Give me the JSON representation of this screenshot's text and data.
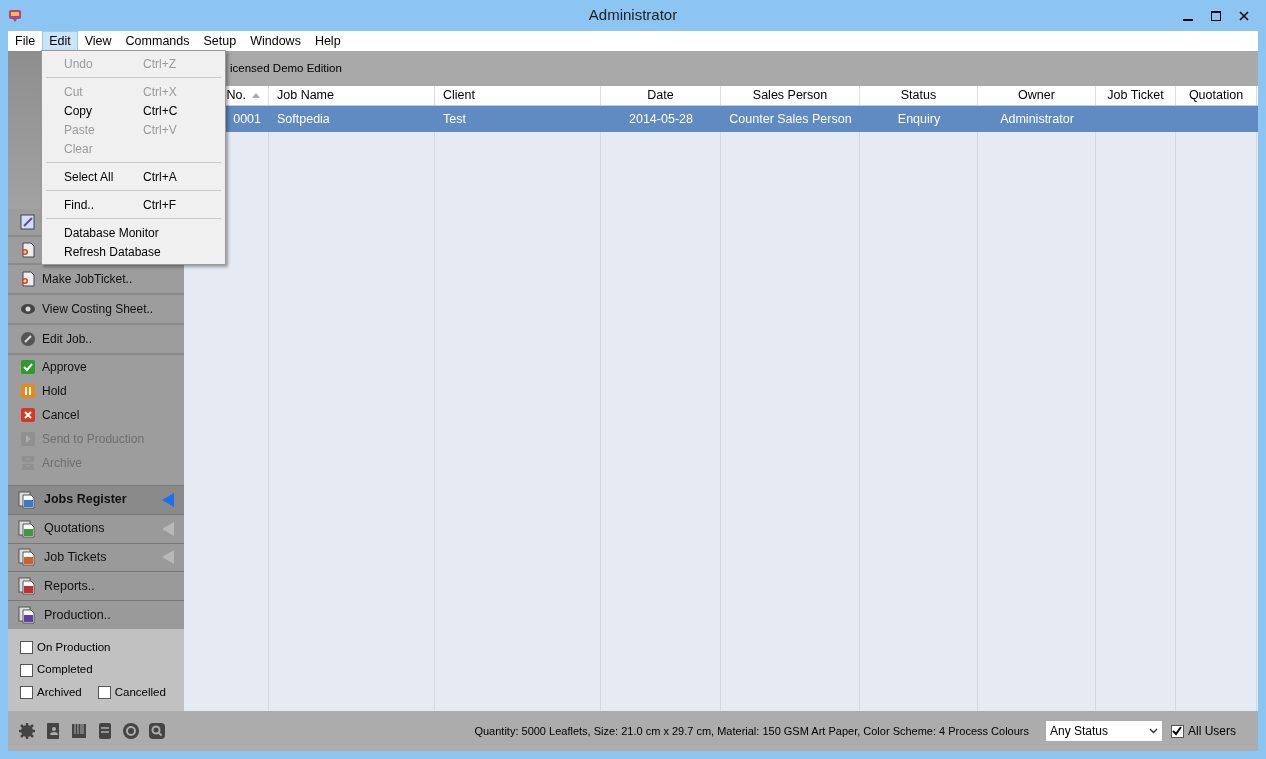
{
  "window": {
    "title": "Administrator"
  },
  "menu_bar": [
    {
      "label": "File",
      "selected": false
    },
    {
      "label": "Edit",
      "selected": true
    },
    {
      "label": "View",
      "selected": false
    },
    {
      "label": "Commands",
      "selected": false
    },
    {
      "label": "Setup",
      "selected": false
    },
    {
      "label": "Windows",
      "selected": false
    },
    {
      "label": "Help",
      "selected": false
    }
  ],
  "edit_menu": [
    {
      "kind": "item",
      "label": "Undo",
      "shortcut": "Ctrl+Z",
      "disabled": true
    },
    {
      "kind": "separator"
    },
    {
      "kind": "item",
      "label": "Cut",
      "shortcut": "Ctrl+X",
      "disabled": true
    },
    {
      "kind": "item",
      "label": "Copy",
      "shortcut": "Ctrl+C",
      "disabled": false
    },
    {
      "kind": "item",
      "label": "Paste",
      "shortcut": "Ctrl+V",
      "disabled": true
    },
    {
      "kind": "item",
      "label": "Clear",
      "disabled": true
    },
    {
      "kind": "separator"
    },
    {
      "kind": "item",
      "label": "Select All",
      "shortcut": "Ctrl+A",
      "disabled": false
    },
    {
      "kind": "separator"
    },
    {
      "kind": "item",
      "label": "Find..",
      "shortcut": "Ctrl+F",
      "disabled": false
    },
    {
      "kind": "separator"
    },
    {
      "kind": "item",
      "label": "Database Monitor",
      "disabled": false
    },
    {
      "kind": "item",
      "label": "Refresh Database",
      "disabled": false
    }
  ],
  "sidebar": {
    "actions": [
      {
        "disabled": false
      },
      {
        "disabled": false
      },
      {
        "label": "Make JobTicket..",
        "disabled": false
      },
      {
        "label": "View Costing Sheet..",
        "disabled": false
      },
      {
        "label": "Edit Job..",
        "disabled": false
      },
      {
        "label": "Approve",
        "disabled": false
      },
      {
        "label": "Hold",
        "disabled": false
      },
      {
        "label": "Cancel",
        "disabled": false
      },
      {
        "label": "Send to Production",
        "disabled": true
      },
      {
        "label": "Archive",
        "disabled": true
      }
    ],
    "nav": [
      {
        "label": "Jobs Register",
        "selected": true,
        "arrow": true
      },
      {
        "label": "Quotations",
        "selected": false,
        "arrow": true
      },
      {
        "label": "Job Tickets",
        "selected": false,
        "arrow": true
      },
      {
        "label": "Reports..",
        "selected": false,
        "arrow": false
      },
      {
        "label": "Production..",
        "selected": false,
        "arrow": false
      }
    ],
    "filters": [
      [
        {
          "label": "On Production",
          "checked": false
        }
      ],
      [
        {
          "label": "Completed",
          "checked": false
        }
      ],
      [
        {
          "label": "Archived",
          "checked": false
        },
        {
          "label": "Cancelled",
          "checked": false
        }
      ]
    ]
  },
  "banner": "icensed Demo Edition",
  "table": {
    "columns": [
      {
        "label": "No.",
        "sorted": true
      },
      {
        "label": "Job Name",
        "sorted": false
      },
      {
        "label": "Client",
        "sorted": false
      },
      {
        "label": "Date",
        "sorted": false
      },
      {
        "label": "Sales Person",
        "sorted": false
      },
      {
        "label": "Status",
        "sorted": false
      },
      {
        "label": "Owner",
        "sorted": false
      },
      {
        "label": "Job Ticket",
        "sorted": false
      },
      {
        "label": "Quotation",
        "sorted": false
      }
    ],
    "rows": [
      {
        "selected": true,
        "cells": [
          "0001",
          "Softpedia",
          "Test",
          "2014-05-28",
          "Counter Sales Person",
          "Enquiry",
          "Administrator",
          "",
          ""
        ]
      }
    ]
  },
  "status_bar": {
    "summary": "Quantity: 5000 Leaflets, Size: 21.0 cm x 29.7 cm, Material: 150 GSM Art Paper, Color Scheme: 4 Process Colours",
    "status_filter": "Any Status",
    "all_users": {
      "label": "All Users",
      "checked": true
    }
  }
}
